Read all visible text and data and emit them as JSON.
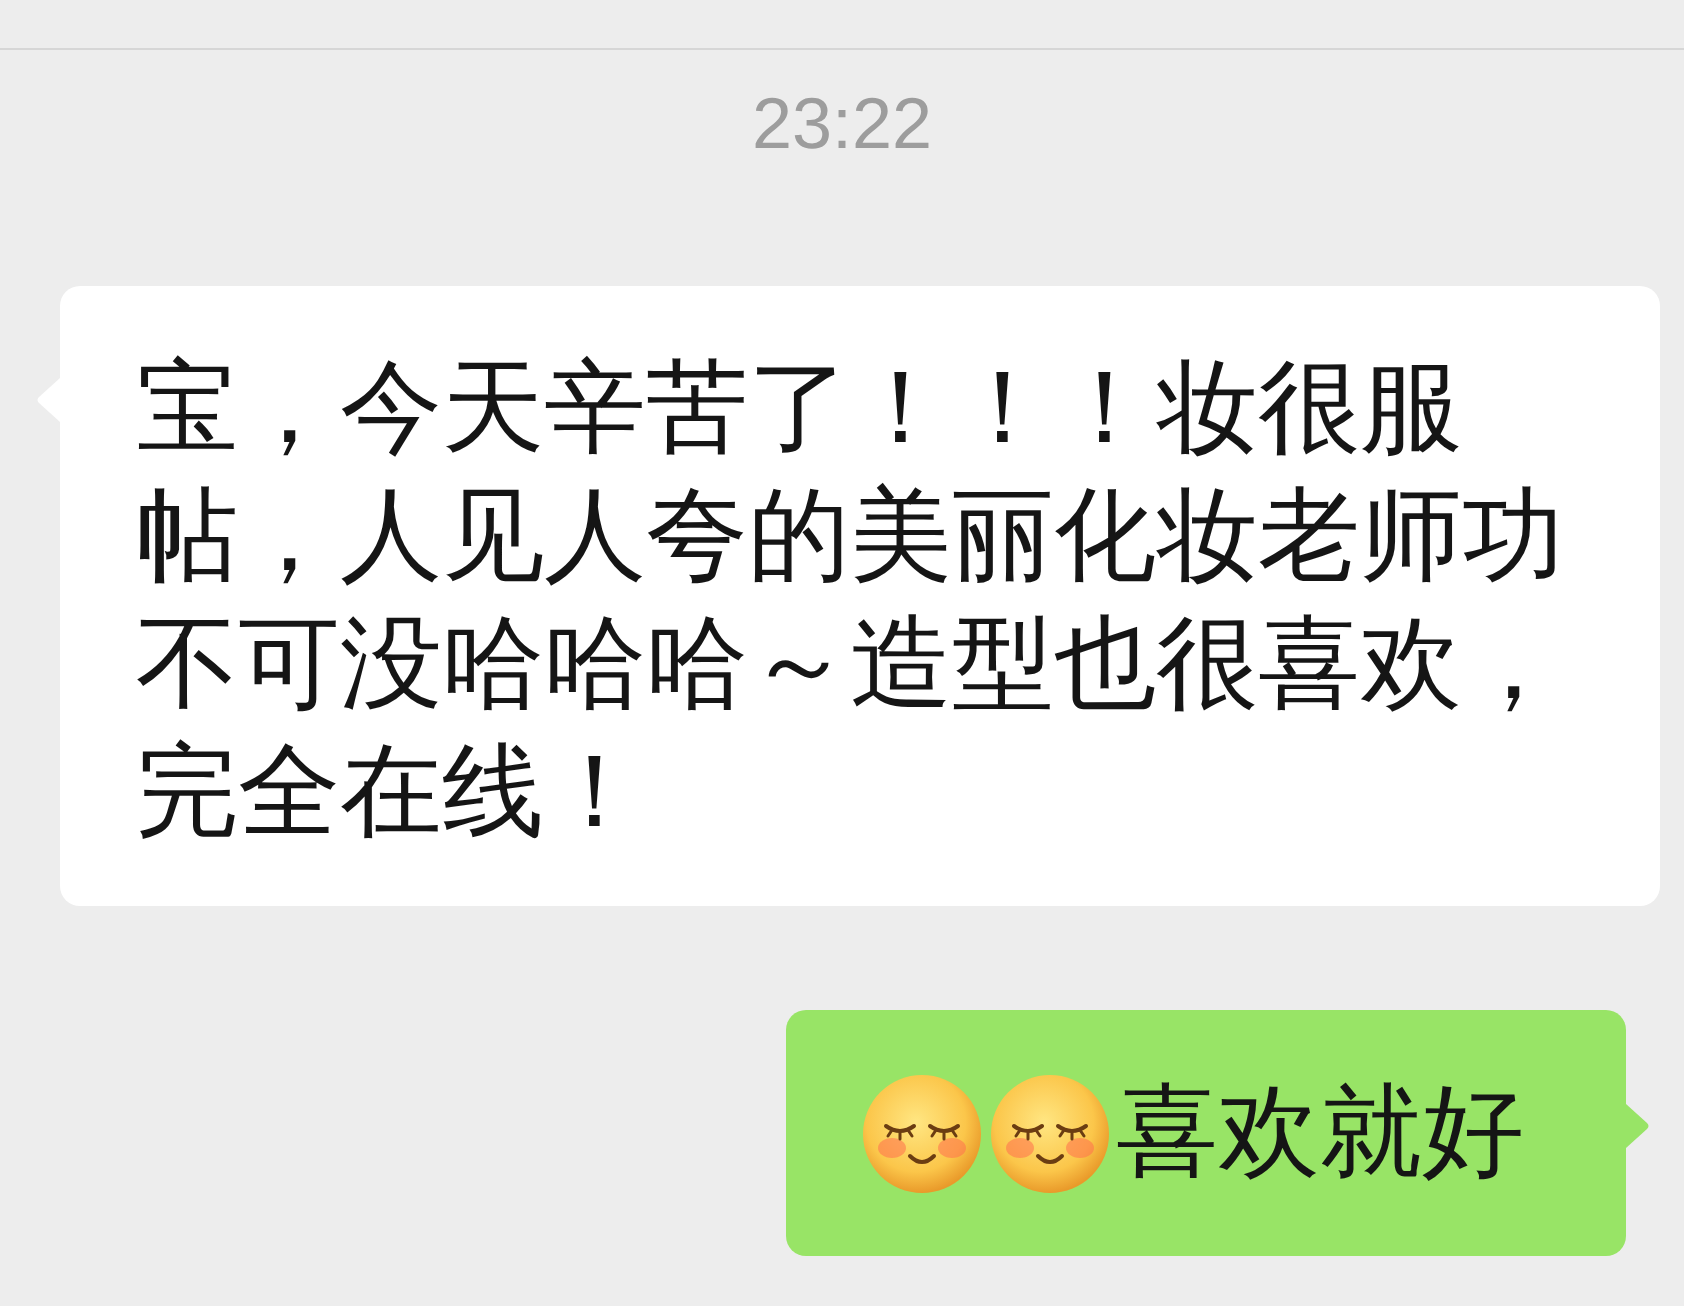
{
  "timestamp": "23:22",
  "messages": [
    {
      "kind": "received",
      "parts": [
        {
          "kind": "text",
          "text": "宝，今天辛苦了！！！妆很服帖，人见人夸的美丽化妆老师功不可没哈哈哈～造型也很喜欢，完全在线！"
        }
      ]
    },
    {
      "kind": "sent",
      "parts": [
        {
          "kind": "emoji"
        },
        {
          "kind": "emoji"
        },
        {
          "kind": "text",
          "text": "喜欢就好"
        }
      ]
    }
  ]
}
